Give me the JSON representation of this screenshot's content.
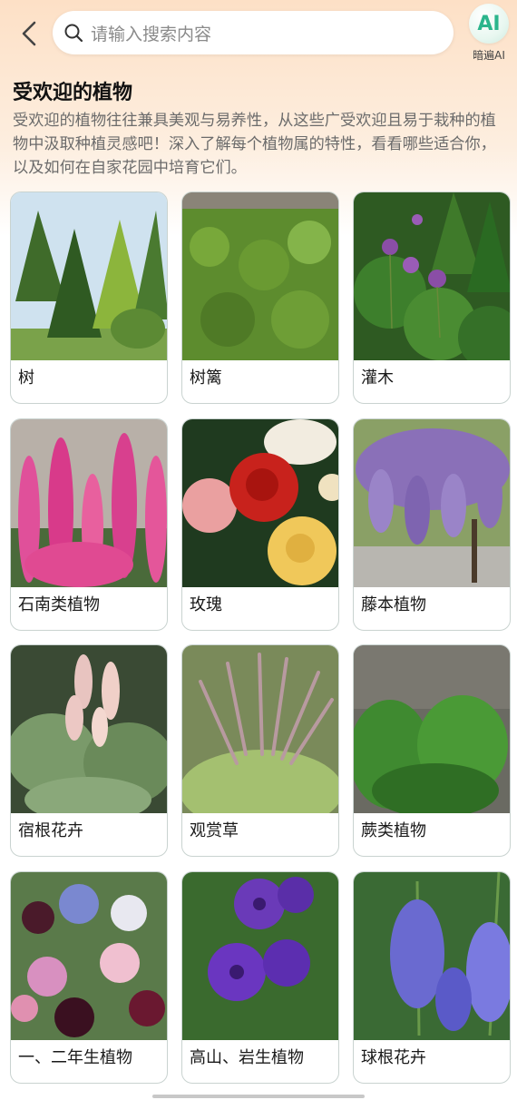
{
  "header": {
    "search_placeholder": "请输入搜索内容",
    "ai_badge": "AI",
    "ai_label": "暗遍AI"
  },
  "section": {
    "title": "受欢迎的植物",
    "description": "受欢迎的植物往往兼具美观与易养性，从这些广受欢迎且易于栽种的植物中汲取种植灵感吧！深入了解每个植物属的特性，看看哪些适合你，以及如何在自家花园中培育它们。"
  },
  "plants": [
    {
      "label": "树",
      "icon": "tree-photo"
    },
    {
      "label": "树篱",
      "icon": "hedge-photo"
    },
    {
      "label": "灌木",
      "icon": "shrub-photo"
    },
    {
      "label": "石南类植物",
      "icon": "heather-photo"
    },
    {
      "label": "玫瑰",
      "icon": "rose-photo"
    },
    {
      "label": "藤本植物",
      "icon": "wisteria-photo"
    },
    {
      "label": "宿根花卉",
      "icon": "perennial-photo"
    },
    {
      "label": "观赏草",
      "icon": "ornamental-grass-photo"
    },
    {
      "label": "蕨类植物",
      "icon": "fern-photo"
    },
    {
      "label": "一、二年生植物",
      "icon": "annual-photo"
    },
    {
      "label": "高山、岩生植物",
      "icon": "alpine-photo"
    },
    {
      "label": "球根花卉",
      "icon": "bulb-photo"
    }
  ]
}
